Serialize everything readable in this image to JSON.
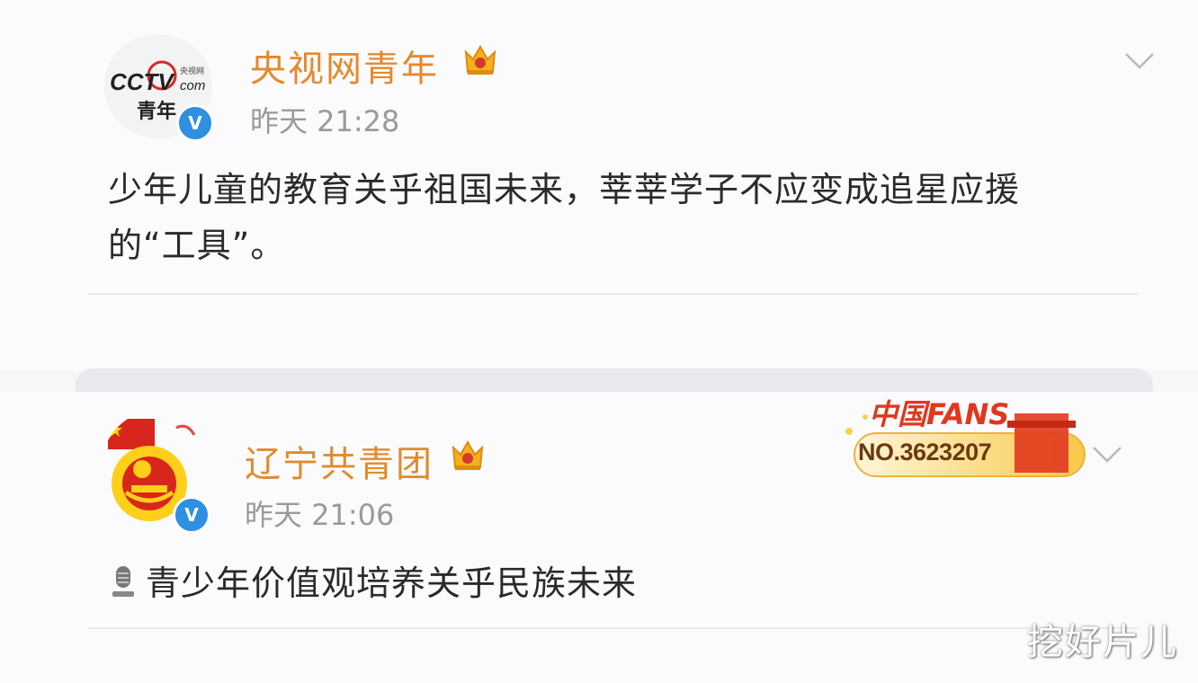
{
  "posts": [
    {
      "avatar_logo": "CCTV",
      "avatar_logo_sub": "央视网",
      "avatar_text": "青年",
      "name": "央视网青年",
      "time": "昨天 21:28",
      "content_line1": "少年儿童的教育关乎祖国未来，莘莘学子不应变成追星应援",
      "content_line2": "的“工具”。"
    },
    {
      "name": "辽宁共青团",
      "time": "昨天 21:06",
      "content": "青少年价值观培养关乎民族未来",
      "fans_badge_title": "中国FANS",
      "fans_badge_number": "NO.3623207"
    }
  ],
  "icons": {
    "verified": "verified-v-icon",
    "crown": "crown-vip-icon",
    "chevron": "chevron-down-icon",
    "mic": "microphone-icon"
  },
  "colors": {
    "name": "#e38a2e",
    "verified": "#2f8fe0",
    "time": "#9a9a9e"
  },
  "watermark": "挖好片儿"
}
